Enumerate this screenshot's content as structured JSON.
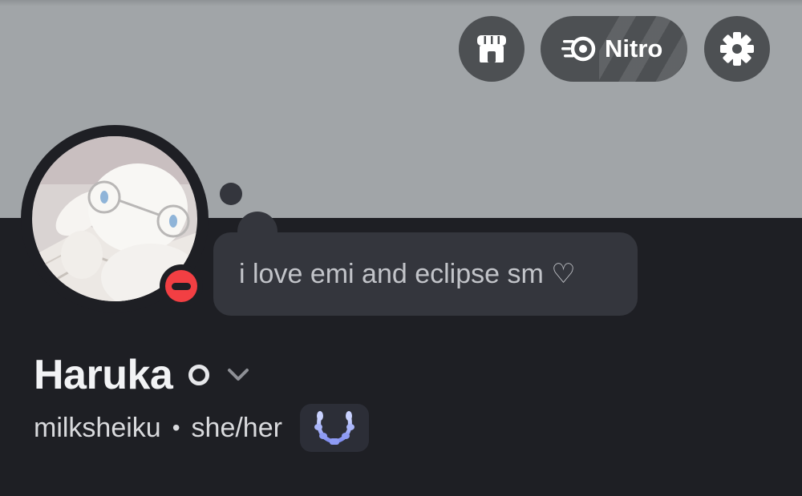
{
  "header": {
    "shop_icon": "shop-icon",
    "nitro_icon": "nitro-icon",
    "nitro_label": "Nitro",
    "settings_icon": "gear-icon"
  },
  "profile": {
    "custom_status": "i love emi and eclipse sm ♡",
    "presence": "do-not-disturb",
    "display_name": "Haruka",
    "username": "milksheiku",
    "separator": "•",
    "pronouns": "she/her",
    "badge_icon": "laurel-badge-icon"
  },
  "colors": {
    "banner": "#a1a5a8",
    "background": "#1e1f24",
    "bubble": "#34363d",
    "dnd": "#f23f43",
    "badge_accent": "#8b9cf7"
  }
}
